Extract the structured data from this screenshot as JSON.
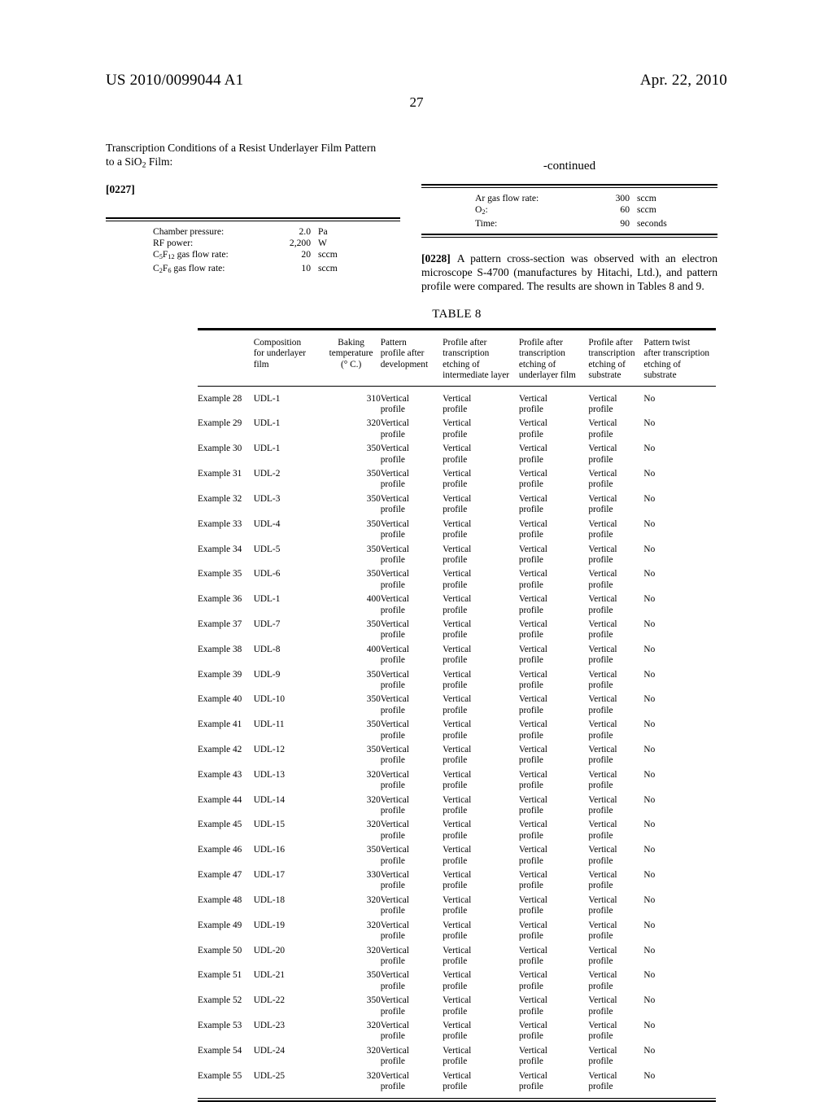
{
  "header": {
    "publication_number": "US 2010/0099044 A1",
    "publication_date": "Apr. 22, 2010",
    "page_number": "27"
  },
  "left_column": {
    "heading_line1": "Transcription Conditions of a Resist Underlayer Film Pattern",
    "heading_line2_pre": "to a SiO",
    "heading_line2_sub": "2",
    "heading_line2_post": " Film:",
    "paragraph_number": "[0227]",
    "conditions": [
      {
        "label": "Chamber pressure:",
        "value": "2.0",
        "unit": "Pa"
      },
      {
        "label": "RF power:",
        "value": "2,200",
        "unit": "W"
      },
      {
        "label_pre": "C",
        "label_sub1": "5",
        "label_mid": "F",
        "label_sub2": "12",
        "label_post": " gas flow rate:",
        "value": "20",
        "unit": "sccm"
      },
      {
        "label_pre": "C",
        "label_sub1": "2",
        "label_mid": "F",
        "label_sub2": "6",
        "label_post": " gas flow rate:",
        "value": "10",
        "unit": "sccm"
      }
    ]
  },
  "right_column": {
    "continued_label": "-continued",
    "conditions": [
      {
        "label": "Ar gas flow rate:",
        "value": "300",
        "unit": "sccm"
      },
      {
        "label_pre": "O",
        "label_sub1": "2",
        "label_post": ":",
        "value": "60",
        "unit": "sccm"
      },
      {
        "label": "Time:",
        "value": "90",
        "unit": "seconds"
      }
    ],
    "paragraph_number": "[0228]",
    "paragraph_text": "A pattern cross-section was observed with an electron microscope S-4700 (manufactures by Hitachi, Ltd.), and pattern profile were compared. The results are shown in Tables 8 and 9."
  },
  "table8": {
    "title": "TABLE 8",
    "columns": [
      {
        "key": "example",
        "header_lines": [
          "",
          "",
          ""
        ]
      },
      {
        "key": "composition",
        "header_lines": [
          "Composition",
          "for underlayer",
          "film"
        ]
      },
      {
        "key": "baking",
        "header_lines": [
          "Baking",
          "temperature",
          "(° C.)"
        ]
      },
      {
        "key": "pattern",
        "header_lines": [
          "Pattern",
          "profile after",
          "development"
        ]
      },
      {
        "key": "intermediate",
        "header_lines": [
          "Profile after",
          "transcription",
          "etching of",
          "intermediate layer"
        ]
      },
      {
        "key": "underlayer",
        "header_lines": [
          "Profile after",
          "transcription",
          "etching of",
          "underlayer film"
        ]
      },
      {
        "key": "substrate",
        "header_lines": [
          "Profile after",
          "transcription",
          "etching of",
          "substrate"
        ]
      },
      {
        "key": "twist",
        "header_lines": [
          "Pattern twist",
          "after transcription",
          "etching of",
          "substrate"
        ]
      }
    ],
    "rows": [
      {
        "example": "Example 28",
        "composition": "UDL-1",
        "baking": "310",
        "pattern": "Vertical profile",
        "intermediate": "Vertical profile",
        "underlayer": "Vertical profile",
        "substrate": "Vertical profile",
        "twist": "No"
      },
      {
        "example": "Example 29",
        "composition": "UDL-1",
        "baking": "320",
        "pattern": "Vertical profile",
        "intermediate": "Vertical profile",
        "underlayer": "Vertical profile",
        "substrate": "Vertical profile",
        "twist": "No"
      },
      {
        "example": "Example 30",
        "composition": "UDL-1",
        "baking": "350",
        "pattern": "Vertical profile",
        "intermediate": "Vertical profile",
        "underlayer": "Vertical profile",
        "substrate": "Vertical profile",
        "twist": "No"
      },
      {
        "example": "Example 31",
        "composition": "UDL-2",
        "baking": "350",
        "pattern": "Vertical profile",
        "intermediate": "Vertical profile",
        "underlayer": "Vertical profile",
        "substrate": "Vertical profile",
        "twist": "No"
      },
      {
        "example": "Example 32",
        "composition": "UDL-3",
        "baking": "350",
        "pattern": "Vertical profile",
        "intermediate": "Vertical profile",
        "underlayer": "Vertical profile",
        "substrate": "Vertical profile",
        "twist": "No"
      },
      {
        "example": "Example 33",
        "composition": "UDL-4",
        "baking": "350",
        "pattern": "Vertical profile",
        "intermediate": "Vertical profile",
        "underlayer": "Vertical profile",
        "substrate": "Vertical profile",
        "twist": "No"
      },
      {
        "example": "Example 34",
        "composition": "UDL-5",
        "baking": "350",
        "pattern": "Vertical profile",
        "intermediate": "Vertical profile",
        "underlayer": "Vertical profile",
        "substrate": "Vertical profile",
        "twist": "No"
      },
      {
        "example": "Example 35",
        "composition": "UDL-6",
        "baking": "350",
        "pattern": "Vertical profile",
        "intermediate": "Vertical profile",
        "underlayer": "Vertical profile",
        "substrate": "Vertical profile",
        "twist": "No"
      },
      {
        "example": "Example 36",
        "composition": "UDL-1",
        "baking": "400",
        "pattern": "Vertical profile",
        "intermediate": "Vertical profile",
        "underlayer": "Vertical profile",
        "substrate": "Vertical profile",
        "twist": "No"
      },
      {
        "example": "Example 37",
        "composition": "UDL-7",
        "baking": "350",
        "pattern": "Vertical profile",
        "intermediate": "Vertical profile",
        "underlayer": "Vertical profile",
        "substrate": "Vertical profile",
        "twist": "No"
      },
      {
        "example": "Example 38",
        "composition": "UDL-8",
        "baking": "400",
        "pattern": "Vertical profile",
        "intermediate": "Vertical profile",
        "underlayer": "Vertical profile",
        "substrate": "Vertical profile",
        "twist": "No"
      },
      {
        "example": "Example 39",
        "composition": "UDL-9",
        "baking": "350",
        "pattern": "Vertical profile",
        "intermediate": "Vertical profile",
        "underlayer": "Vertical profile",
        "substrate": "Vertical profile",
        "twist": "No"
      },
      {
        "example": "Example 40",
        "composition": "UDL-10",
        "baking": "350",
        "pattern": "Vertical profile",
        "intermediate": "Vertical profile",
        "underlayer": "Vertical profile",
        "substrate": "Vertical profile",
        "twist": "No"
      },
      {
        "example": "Example 41",
        "composition": "UDL-11",
        "baking": "350",
        "pattern": "Vertical profile",
        "intermediate": "Vertical profile",
        "underlayer": "Vertical profile",
        "substrate": "Vertical profile",
        "twist": "No"
      },
      {
        "example": "Example 42",
        "composition": "UDL-12",
        "baking": "350",
        "pattern": "Vertical profile",
        "intermediate": "Vertical profile",
        "underlayer": "Vertical profile",
        "substrate": "Vertical profile",
        "twist": "No"
      },
      {
        "example": "Example 43",
        "composition": "UDL-13",
        "baking": "320",
        "pattern": "Vertical profile",
        "intermediate": "Vertical profile",
        "underlayer": "Vertical profile",
        "substrate": "Vertical profile",
        "twist": "No"
      },
      {
        "example": "Example 44",
        "composition": "UDL-14",
        "baking": "320",
        "pattern": "Vertical profile",
        "intermediate": "Vertical profile",
        "underlayer": "Vertical profile",
        "substrate": "Vertical profile",
        "twist": "No"
      },
      {
        "example": "Example 45",
        "composition": "UDL-15",
        "baking": "320",
        "pattern": "Vertical profile",
        "intermediate": "Vertical profile",
        "underlayer": "Vertical profile",
        "substrate": "Vertical profile",
        "twist": "No"
      },
      {
        "example": "Example 46",
        "composition": "UDL-16",
        "baking": "350",
        "pattern": "Vertical profile",
        "intermediate": "Vertical profile",
        "underlayer": "Vertical profile",
        "substrate": "Vertical profile",
        "twist": "No"
      },
      {
        "example": "Example 47",
        "composition": "UDL-17",
        "baking": "330",
        "pattern": "Vertical profile",
        "intermediate": "Vertical profile",
        "underlayer": "Vertical profile",
        "substrate": "Vertical profile",
        "twist": "No"
      },
      {
        "example": "Example 48",
        "composition": "UDL-18",
        "baking": "320",
        "pattern": "Vertical profile",
        "intermediate": "Vertical profile",
        "underlayer": "Vertical profile",
        "substrate": "Vertical profile",
        "twist": "No"
      },
      {
        "example": "Example 49",
        "composition": "UDL-19",
        "baking": "320",
        "pattern": "Vertical profile",
        "intermediate": "Vertical profile",
        "underlayer": "Vertical profile",
        "substrate": "Vertical profile",
        "twist": "No"
      },
      {
        "example": "Example 50",
        "composition": "UDL-20",
        "baking": "320",
        "pattern": "Vertical profile",
        "intermediate": "Vertical profile",
        "underlayer": "Vertical profile",
        "substrate": "Vertical profile",
        "twist": "No"
      },
      {
        "example": "Example 51",
        "composition": "UDL-21",
        "baking": "350",
        "pattern": "Vertical profile",
        "intermediate": "Vertical profile",
        "underlayer": "Vertical profile",
        "substrate": "Vertical profile",
        "twist": "No"
      },
      {
        "example": "Example 52",
        "composition": "UDL-22",
        "baking": "350",
        "pattern": "Vertical profile",
        "intermediate": "Vertical profile",
        "underlayer": "Vertical profile",
        "substrate": "Vertical profile",
        "twist": "No"
      },
      {
        "example": "Example 53",
        "composition": "UDL-23",
        "baking": "320",
        "pattern": "Vertical profile",
        "intermediate": "Vertical profile",
        "underlayer": "Vertical profile",
        "substrate": "Vertical profile",
        "twist": "No"
      },
      {
        "example": "Example 54",
        "composition": "UDL-24",
        "baking": "320",
        "pattern": "Vertical profile",
        "intermediate": "Vertical profile",
        "underlayer": "Vertical profile",
        "substrate": "Vertical profile",
        "twist": "No"
      },
      {
        "example": "Example 55",
        "composition": "UDL-25",
        "baking": "320",
        "pattern": "Vertical profile",
        "intermediate": "Vertical profile",
        "underlayer": "Vertical profile",
        "substrate": "Vertical profile",
        "twist": "No"
      }
    ]
  }
}
